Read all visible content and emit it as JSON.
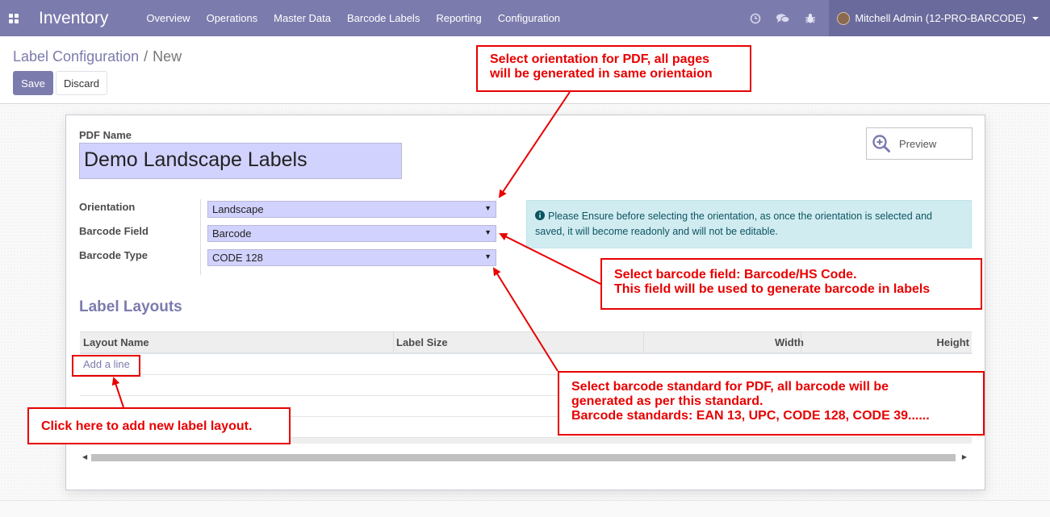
{
  "navbar": {
    "app_name": "Inventory",
    "menu": [
      "Overview",
      "Operations",
      "Master Data",
      "Barcode Labels",
      "Reporting",
      "Configuration"
    ],
    "icons": [
      "clock-icon",
      "chat-icon",
      "bug-icon"
    ],
    "user": "Mitchell Admin (12-PRO-BARCODE)",
    "color": "#7c7bad"
  },
  "breadcrumb": {
    "parent": "Label Configuration",
    "separator": "/",
    "current": "New"
  },
  "buttons": {
    "save": "Save",
    "discard": "Discard",
    "preview": "Preview"
  },
  "form": {
    "pdf_name_label": "PDF Name",
    "pdf_name_value": "Demo Landscape Labels",
    "orientation_label": "Orientation",
    "orientation_value": "Landscape",
    "barcode_field_label": "Barcode Field",
    "barcode_field_value": "Barcode",
    "barcode_type_label": "Barcode Type",
    "barcode_type_value": "CODE 128",
    "info_text": "Please Ensure before selecting the orientation, as once the orientation is selected and saved, it will become readonly and will not be editable.",
    "section_title": "Label Layouts",
    "table_headers": [
      "Layout Name",
      "Label Size",
      "Width",
      "Height"
    ],
    "add_line": "Add a line"
  },
  "annotations": {
    "orientation": [
      "Select orientation for PDF, all pages",
      "will be generated in same orientaion"
    ],
    "barcode_field": [
      "Select barcode field: Barcode/HS Code.",
      "This field will be used to generate barcode in labels"
    ],
    "barcode_type": [
      "Select barcode standard for PDF, all barcode will be",
      "generated as per this standard.",
      "Barcode standards: EAN 13, UPC, CODE 128, CODE 39......"
    ],
    "add_line": [
      "Click here to add new label layout."
    ],
    "color": "#e80000"
  }
}
